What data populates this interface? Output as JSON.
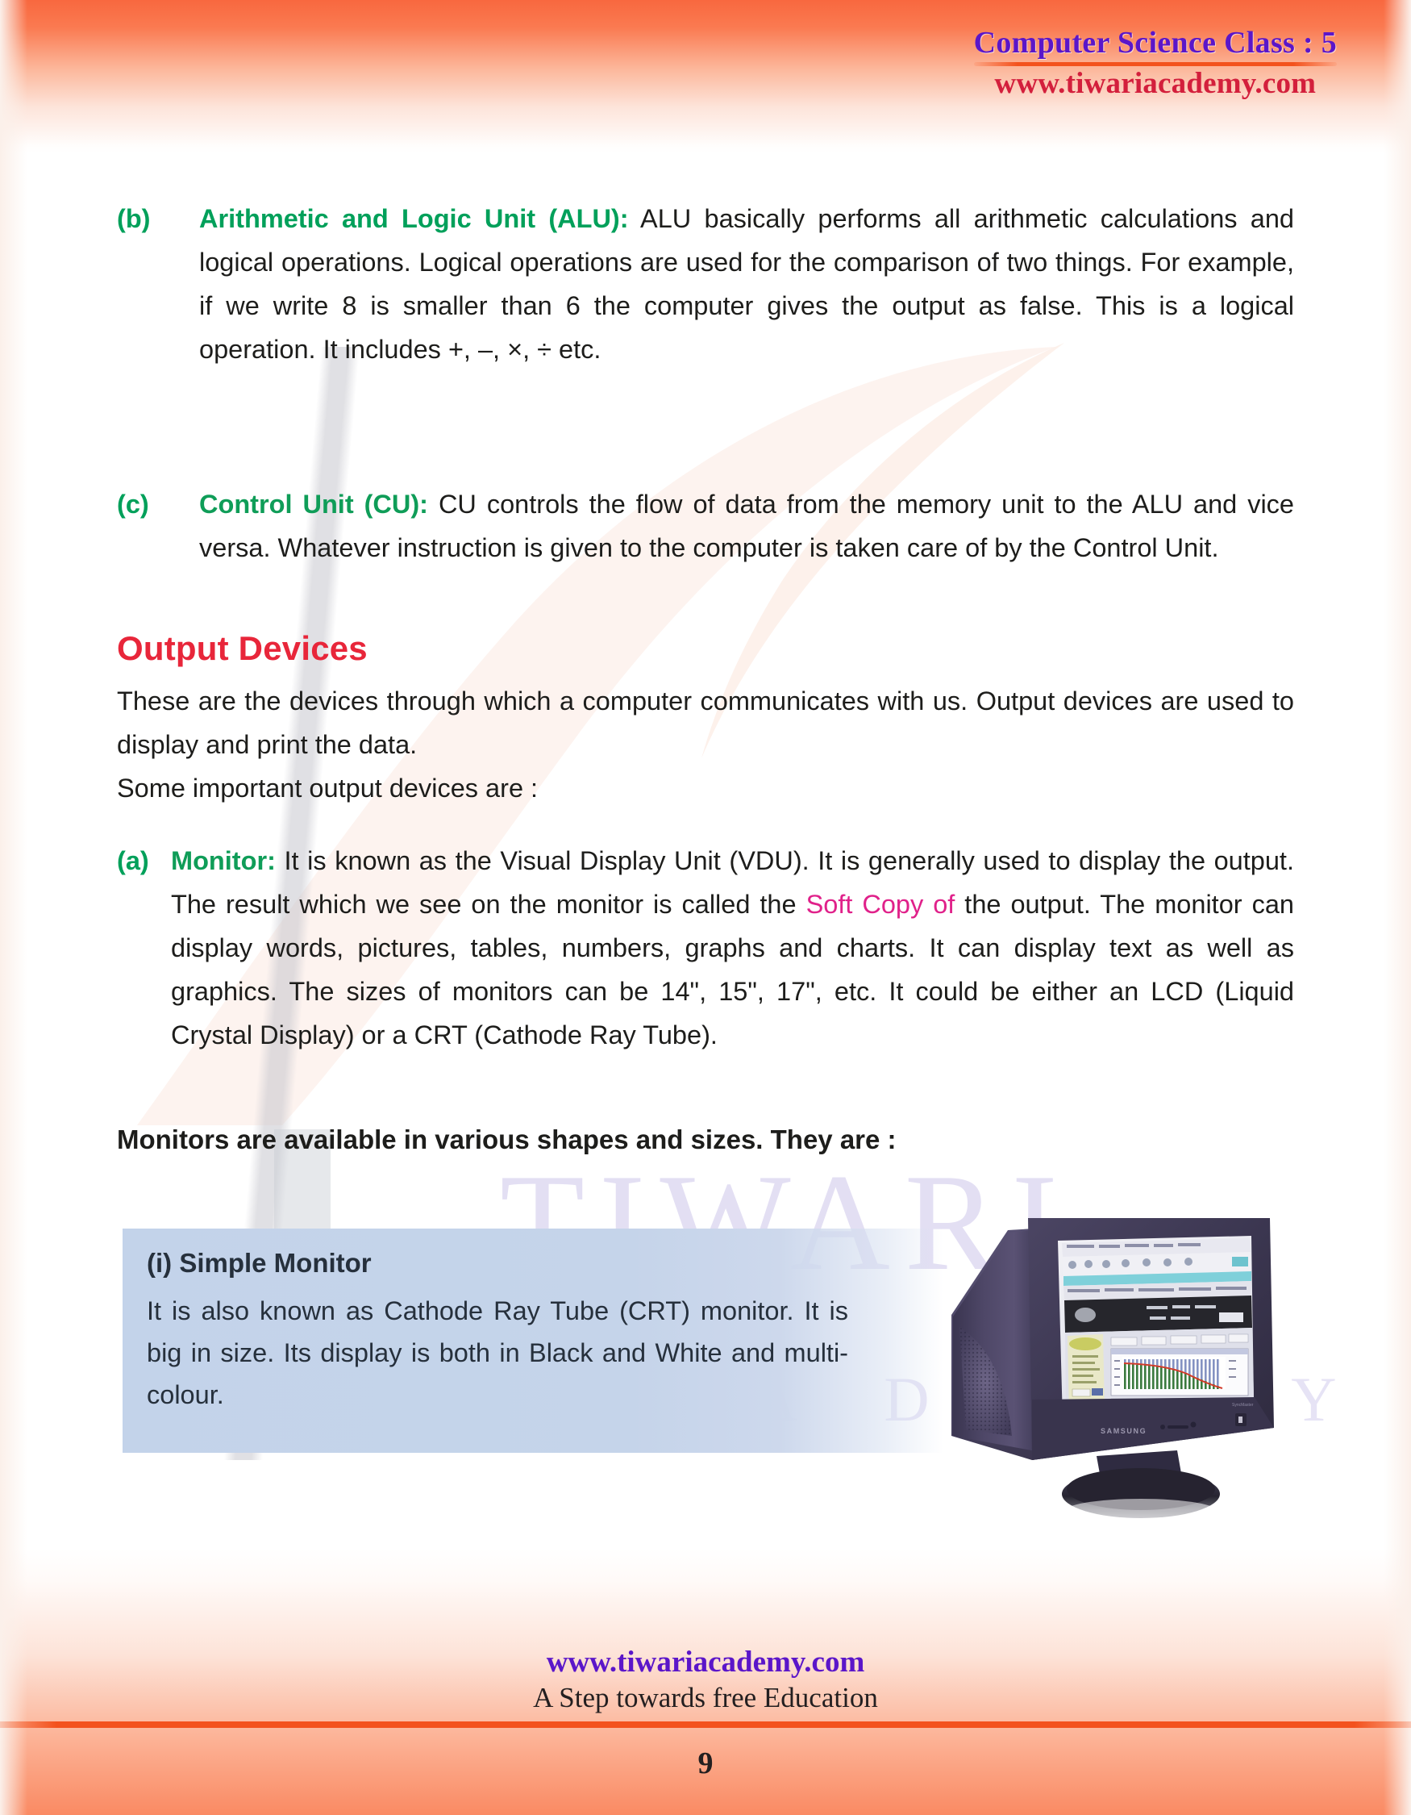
{
  "header": {
    "title": "Computer Science Class : 5",
    "site": "www.tiwariacademy.com"
  },
  "watermark": {
    "word_top": "TIWARI",
    "word_bottom": "A C A D E M Y"
  },
  "body": {
    "item_b": {
      "marker": "(b)",
      "label": "Arithmetic and Logic Unit (ALU):",
      "text": " ALU basically performs all arithmetic calculations and logical operations. Logical operations are used for the comparison of two things. For example, if we write 8 is smaller than 6 the computer gives the output as false. This is a logical operation. It includes +, –, ×, ÷ etc."
    },
    "item_c": {
      "marker": "(c)",
      "label": "Control Unit (CU):",
      "text": " CU controls the flow of data from the memory unit to the ALU and vice versa. Whatever instruction is given to the computer is taken care of by the Control Unit."
    },
    "section_heading": "Output Devices",
    "intro_1": "These are the devices through which a computer communicates with us. Output devices are used to display and print the data.",
    "intro_2": "Some important output devices are :",
    "item_a": {
      "marker": "(a)",
      "label": "Monitor:",
      "text_1": " It is known as the Visual Display Unit (VDU). It is generally used to display the output. The result which we see on the monitor is called the ",
      "highlight": "Soft Copy of",
      "text_2": " the output. The monitor can display words, pictures, tables, numbers, graphs and charts. It can display text as well as graphics. The sizes of monitors can be 14\", 15\", 17\", etc. It could be either an LCD (Liquid Crystal Display) or a CRT (Cathode Ray Tube)."
    },
    "bold_note": "Monitors are available in various shapes and sizes. They are :"
  },
  "callout": {
    "title": "(i) Simple Monitor",
    "text": "It is also known as Cathode Ray Tube (CRT) monitor. It is big in size. Its display is both in Black and White and multi-colour."
  },
  "monitor_image": {
    "brand": "SAMSUNG",
    "caption": "crt-monitor-photo"
  },
  "footer": {
    "site": "www.tiwariacademy.com",
    "tagline": "A Step towards free Education",
    "page_number": "9"
  },
  "colors": {
    "accent_orange": "#f3521d",
    "header_purple": "#5b16c9",
    "header_red": "#d31f3c",
    "label_green": "#00a05a",
    "heading_red": "#e8263a",
    "highlight_pink": "#e0218a",
    "callout_blue": "#c5d4ea"
  }
}
